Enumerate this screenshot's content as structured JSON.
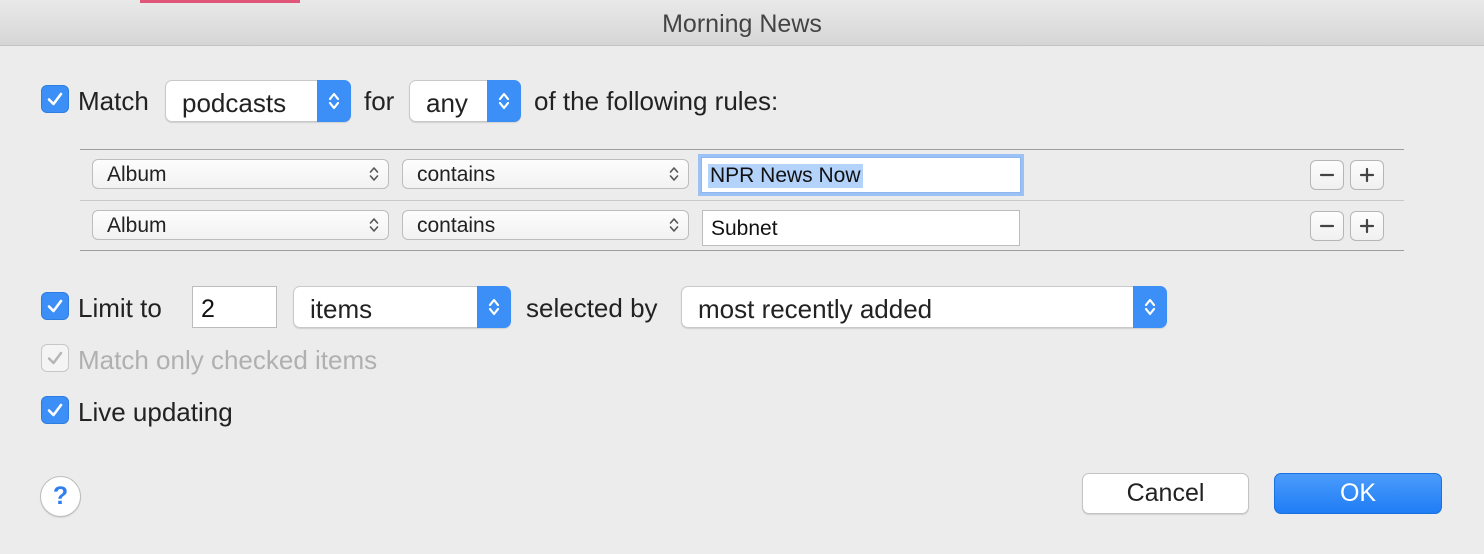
{
  "window": {
    "title": "Morning News"
  },
  "match": {
    "checked": true,
    "label": "Match",
    "media_value": "podcasts",
    "for_label": "for",
    "quantifier_value": "any",
    "suffix": "of the following rules:"
  },
  "rules": [
    {
      "field": "Album",
      "operator": "contains",
      "value": "NPR News Now",
      "focused": true
    },
    {
      "field": "Album",
      "operator": "contains",
      "value": "Subnet",
      "focused": false
    }
  ],
  "limit": {
    "checked": true,
    "label": "Limit to",
    "count": "2",
    "unit_value": "items",
    "selected_by_label": "selected by",
    "order_value": "most recently added"
  },
  "match_checked": {
    "checked": true,
    "disabled": true,
    "label": "Match only checked items"
  },
  "live_updating": {
    "checked": true,
    "label": "Live updating"
  },
  "buttons": {
    "help": "?",
    "cancel": "Cancel",
    "ok": "OK"
  },
  "colors": {
    "accent": "#3b8ff7",
    "ok_button": "#1f7df5",
    "title_strip": "#e0567a"
  }
}
